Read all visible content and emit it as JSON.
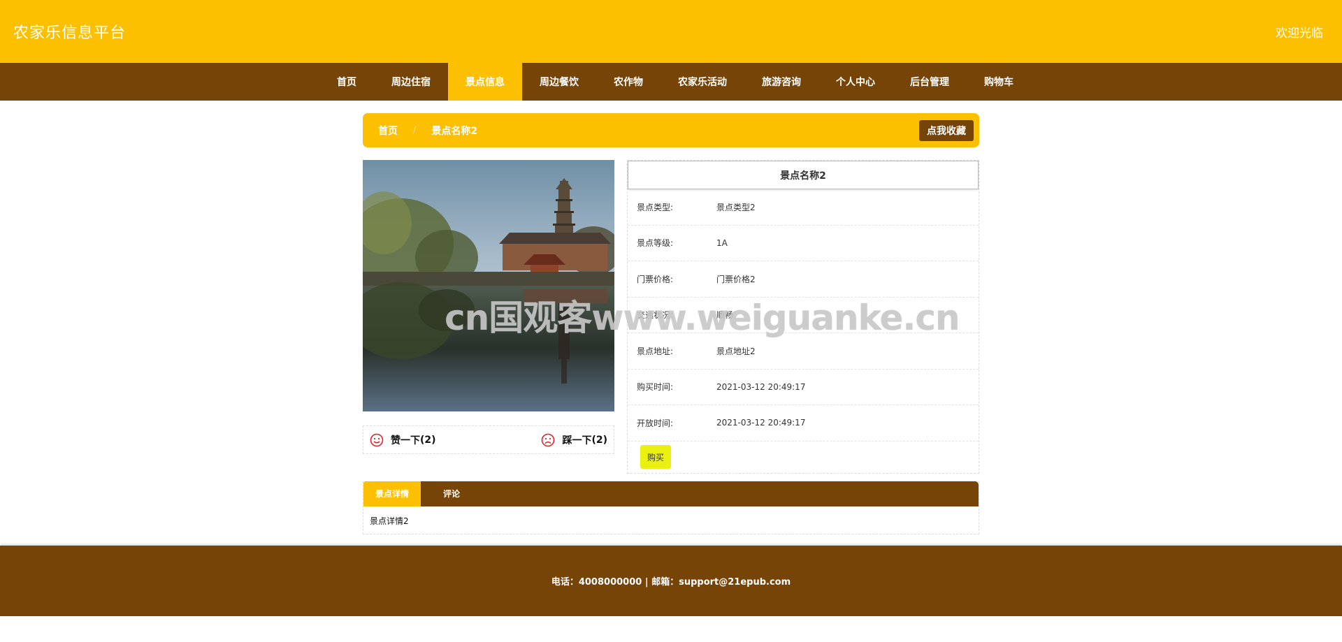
{
  "header": {
    "site_title": "农家乐信息平台",
    "welcome": "欢迎光临"
  },
  "nav": {
    "items": [
      {
        "label": "首页"
      },
      {
        "label": "周边住宿"
      },
      {
        "label": "景点信息",
        "active": true
      },
      {
        "label": "周边餐饮"
      },
      {
        "label": "农作物"
      },
      {
        "label": "农家乐活动"
      },
      {
        "label": "旅游咨询"
      },
      {
        "label": "个人中心"
      },
      {
        "label": "后台管理"
      },
      {
        "label": "购物车"
      }
    ]
  },
  "breadcrumb": {
    "home": "首页",
    "separator": "/",
    "current": "景点名称2",
    "favorite_button": "点我收藏"
  },
  "votes": {
    "like_label": "赞一下",
    "like_count": "(2)",
    "dislike_label": "踩一下",
    "dislike_count": "(2)"
  },
  "info": {
    "title": "景点名称2",
    "rows": [
      {
        "label": "景点类型:",
        "value": "景点类型2"
      },
      {
        "label": "景点等级:",
        "value": "1A"
      },
      {
        "label": "门票价格:",
        "value": "门票价格2"
      },
      {
        "label": "交通状况:",
        "value": "顺畅"
      },
      {
        "label": "景点地址:",
        "value": "景点地址2"
      },
      {
        "label": "购买时间:",
        "value": "2021-03-12 20:49:17"
      },
      {
        "label": "开放时间:",
        "value": "2021-03-12 20:49:17"
      }
    ],
    "buy_button": "购买"
  },
  "tabs": {
    "items": [
      {
        "label": "景点详情",
        "active": true
      },
      {
        "label": "评论"
      }
    ],
    "content": "景点详情2"
  },
  "watermark": "cn国观客www.weiguanke.cn",
  "footer": {
    "text": "电话：4008000000 | 邮箱：support@21epub.com"
  },
  "colors": {
    "primary_yellow": "#fcc000",
    "primary_brown": "#774407",
    "buy_button": "#eaf00f",
    "vote_icon": "#e0242a"
  }
}
